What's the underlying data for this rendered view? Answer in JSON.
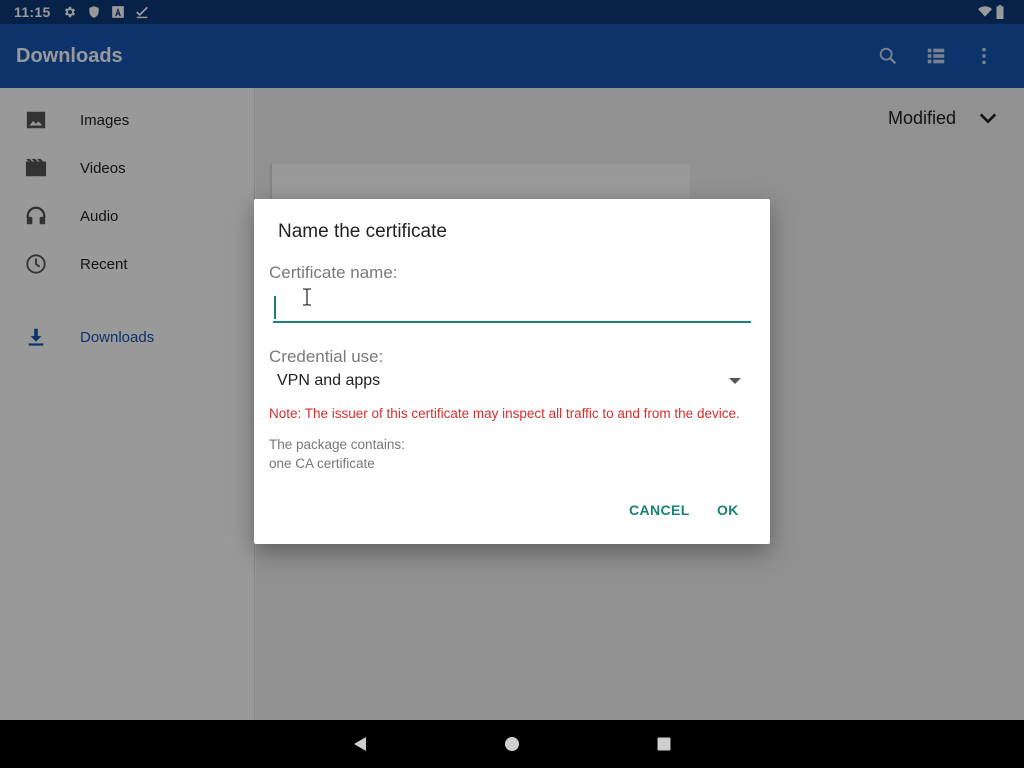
{
  "status_bar": {
    "time": "11:15",
    "icons": [
      "gear-icon",
      "shield-icon",
      "font-icon",
      "check-icon"
    ],
    "right_icons": [
      "wifi-icon",
      "battery-icon"
    ]
  },
  "app_bar": {
    "title": "Downloads",
    "actions": [
      "search-icon",
      "list-view-icon",
      "more-vert-icon"
    ],
    "color": "#1656b4"
  },
  "sidebar": {
    "items": [
      {
        "label": "Images",
        "icon": "image-icon"
      },
      {
        "label": "Videos",
        "icon": "movie-icon"
      },
      {
        "label": "Audio",
        "icon": "headphones-icon"
      },
      {
        "label": "Recent",
        "icon": "clock-icon"
      },
      {
        "label": "Downloads",
        "icon": "download-icon",
        "active": true
      }
    ]
  },
  "main": {
    "sort_label": "Modified"
  },
  "dialog": {
    "title": "Name the certificate",
    "name_label": "Certificate name:",
    "name_value": "",
    "use_label": "Credential use:",
    "use_value": "VPN and apps",
    "note": "Note: The issuer of this certificate may inspect all traffic to and from the device.",
    "package_line1": "The package contains:",
    "package_line2": "one CA certificate",
    "cancel": "CANCEL",
    "ok": "OK",
    "accent": "#1a8273",
    "note_color": "#d32f2f"
  },
  "nav_bar": {
    "buttons": [
      "back-icon",
      "home-icon",
      "recents-icon"
    ]
  }
}
